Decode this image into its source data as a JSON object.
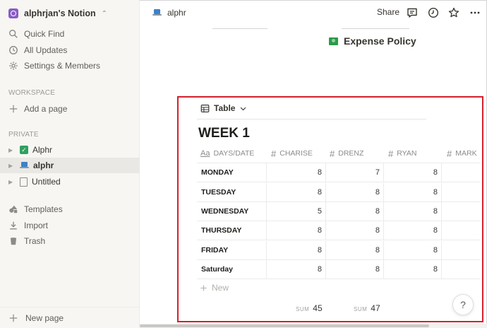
{
  "workspace": {
    "name": "alphrjan's Notion"
  },
  "sidebar": {
    "top_items": [
      {
        "label": "Quick Find",
        "icon": "search-icon"
      },
      {
        "label": "All Updates",
        "icon": "clock-icon"
      },
      {
        "label": "Settings & Members",
        "icon": "gear-icon"
      }
    ],
    "workspace_heading": "WORKSPACE",
    "add_page": "Add a page",
    "private_heading": "PRIVATE",
    "pages": [
      {
        "label": "Alphr",
        "icon": "checkbox-icon"
      },
      {
        "label": "alphr",
        "icon": "laptop-icon",
        "active": true
      },
      {
        "label": "Untitled",
        "icon": "document-icon"
      }
    ],
    "bottom_items": [
      {
        "label": "Templates",
        "icon": "templates-icon"
      },
      {
        "label": "Import",
        "icon": "import-icon"
      },
      {
        "label": "Trash",
        "icon": "trash-icon"
      }
    ],
    "new_page": "New page"
  },
  "topbar": {
    "breadcrumb": "alphr",
    "share_label": "Share"
  },
  "page": {
    "linked_page": "Expense Policy",
    "view_name": "Table",
    "db_title": "WEEK 1",
    "columns": [
      {
        "label": "DAYS/DATE",
        "type": "title"
      },
      {
        "label": "CHARISE",
        "type": "number"
      },
      {
        "label": "DRENZ",
        "type": "number"
      },
      {
        "label": "RYAN",
        "type": "number"
      },
      {
        "label": "MARK",
        "type": "number"
      }
    ],
    "rows": [
      {
        "day": "MONDAY",
        "values": [
          "8",
          "7",
          "8"
        ]
      },
      {
        "day": "TUESDAY",
        "values": [
          "8",
          "8",
          "8"
        ]
      },
      {
        "day": "WEDNESDAY",
        "values": [
          "5",
          "8",
          "8"
        ]
      },
      {
        "day": "THURSDAY",
        "values": [
          "8",
          "8",
          "8"
        ]
      },
      {
        "day": "FRIDAY",
        "values": [
          "8",
          "8",
          "8"
        ]
      },
      {
        "day": "Saturday",
        "values": [
          "8",
          "8",
          "8"
        ]
      }
    ],
    "new_row_label": "New",
    "sums": [
      {
        "label": "SUM",
        "value": "45"
      },
      {
        "label": "SUM",
        "value": "47"
      }
    ],
    "help_label": "?"
  },
  "colors": {
    "highlight": "#d3202b",
    "sidebar_bg": "#f7f6f3",
    "workspace_icon": "#8a5cc8"
  }
}
